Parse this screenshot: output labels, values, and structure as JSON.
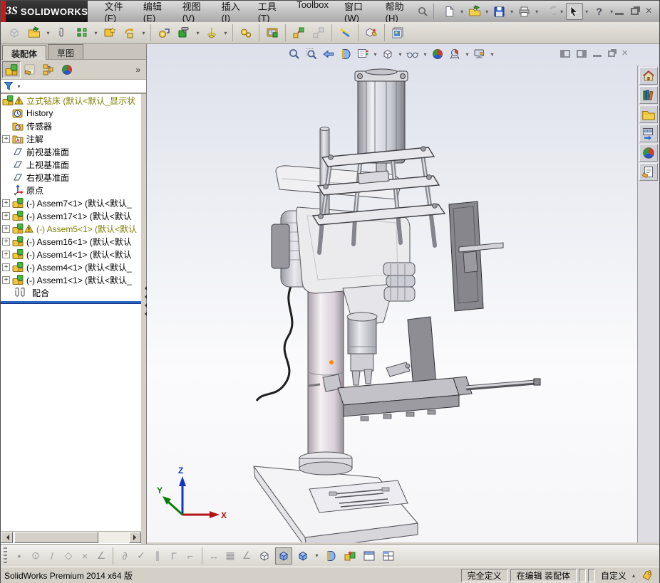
{
  "window": {
    "logo_prefix": "3S",
    "logo_text": "SOLIDWORKS",
    "accent_red": "#c81b1e"
  },
  "menubar": {
    "items": [
      "文件(F)",
      "编辑(E)",
      "视图(V)",
      "插入(I)",
      "工具(T)",
      "Toolbox",
      "窗口(W)",
      "帮助(H)"
    ]
  },
  "quickbar": {
    "icons": [
      "new-document",
      "open-document",
      "save",
      "print",
      "undo",
      "select-cursor",
      "help"
    ]
  },
  "window_controls": [
    "minimize",
    "restore",
    "close"
  ],
  "assembly_toolbar": {
    "icons": [
      "insert-component",
      "insert-components",
      "mate",
      "linear-component-pattern",
      "smart-fasteners",
      "move-component",
      "show-hidden-components",
      "assembly-features",
      "reference-geometry",
      "new-motion-study",
      "bill-of-materials",
      "exploded-view",
      "explode-line-sketch",
      "instant3d",
      "interference-detection",
      "take-snapshot"
    ]
  },
  "left_panel": {
    "tabs": [
      {
        "label": "装配体",
        "active": true
      },
      {
        "label": "草图",
        "active": false
      }
    ],
    "manager_tabs": [
      "featuremanager-design-tree",
      "propertymanager",
      "configurationmanager",
      "displaymanager"
    ],
    "overflow_label": "»",
    "warning_text_color": "#7f7f00",
    "rollback_bar_color": "#2e63c6",
    "tree": {
      "items": [
        {
          "label": "立式钻床 (默认<默认_显示状",
          "icon": "assembly",
          "warning": true
        },
        {
          "label": "History",
          "icon": "history-clock"
        },
        {
          "label": "传感器",
          "icon": "sensors-folder"
        },
        {
          "label": "注解",
          "icon": "annotations-folder",
          "expandable": true
        },
        {
          "label": "前视基准面",
          "icon": "plane"
        },
        {
          "label": "上视基准面",
          "icon": "plane"
        },
        {
          "label": "右视基准面",
          "icon": "plane"
        },
        {
          "label": "原点",
          "icon": "origin"
        },
        {
          "label": "(-) Assem7<1> (默认<默认_",
          "icon": "assembly",
          "expandable": true
        },
        {
          "label": "(-) Assem17<1> (默认<默认",
          "icon": "assembly",
          "expandable": true
        },
        {
          "label": "(-) Assem5<1> (默认<默认",
          "icon": "assembly",
          "expandable": true,
          "warning": true
        },
        {
          "label": "(-) Assem16<1> (默认<默认",
          "icon": "assembly",
          "expandable": true
        },
        {
          "label": "(-) Assem14<1> (默认<默认",
          "icon": "assembly",
          "expandable": true
        },
        {
          "label": "(-) Assem4<1> (默认<默认_",
          "icon": "assembly",
          "expandable": true
        },
        {
          "label": "(-) Assem1<1> (默认<默认_",
          "icon": "assembly",
          "expandable": true
        },
        {
          "label": "配合",
          "icon": "mates-paperclip"
        }
      ]
    }
  },
  "viewport": {
    "headsup_icons": [
      "zoom-to-fit",
      "zoom-to-area",
      "previous-view",
      "section-view",
      "view-orientation",
      "display-style",
      "hide-show-items",
      "edit-appearance",
      "apply-scene",
      "view-settings"
    ],
    "doc_controls": [
      "pane-left",
      "pane-right",
      "doc-minimize",
      "doc-restore",
      "doc-close"
    ],
    "model": "vertical-drill-press-assembly",
    "triad": {
      "x": "X",
      "y": "Y",
      "z": "Z"
    },
    "bg_top": "#dde0ea",
    "bg_bottom": "#f6f6f8"
  },
  "task_pane": {
    "icons": [
      "solidworks-resources",
      "design-library",
      "file-explorer",
      "view-palette",
      "appearances-scenes",
      "custom-properties"
    ]
  },
  "sketch_toolbar": {
    "icons": [
      "sketch-point",
      "sketch-circle",
      "sketch-line",
      "sketch-polygon",
      "sketch-trim",
      "sketch-chamfer",
      "tangent-arc",
      "convert-entities",
      "parallel-relation",
      "corner-rectangle",
      "construction-geometry",
      "smart-dimension",
      "grid-snap",
      "angle-snap",
      "wireframe",
      "shaded-with-edges",
      "shaded",
      "section-view",
      "collision-detection",
      "viewport-single",
      "viewport-four"
    ]
  },
  "statusbar": {
    "left": "SolidWorks Premium 2014 x64 版",
    "define_state": "完全定义",
    "edit_state": "在编辑 装配体",
    "custom_label": "自定义"
  }
}
